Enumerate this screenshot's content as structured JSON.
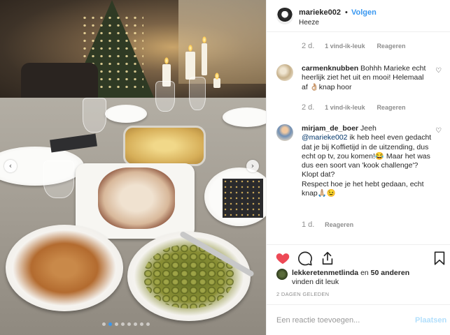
{
  "header": {
    "username": "marieke002",
    "separator": "•",
    "follow_label": "Volgen",
    "location": "Heeze"
  },
  "comments": [
    {
      "username": "",
      "text": "",
      "time": "2 d.",
      "likes": "1 vind-ik-leuk",
      "reply": "Reageren"
    },
    {
      "username": "carmenknubben",
      "text": "Bohhh Marieke echt heerlijk ziet het uit en mooi! Helemaal af 👌🏼knap hoor",
      "time": "2 d.",
      "likes": "1 vind-ik-leuk",
      "reply": "Reageren"
    },
    {
      "username": "mirjam_de_boer",
      "mention": "@marieke002",
      "text_before": "Jeeh",
      "text": "ik heb heel even gedacht dat je bij Koffietijd in de uitzending, dus echt op tv, zou komen!😂 Maar het was dus een soort van 'kook challenge'? Klopt dat?",
      "text_2": "Respect hoe je het hebt gedaan, echt knap🙏🏼😉",
      "time": "1 d.",
      "reply": "Reageren"
    }
  ],
  "likes": {
    "first_liker": "lekkeretenmetlinda",
    "connector": "en",
    "others": "50 anderen",
    "suffix": "vinden dit leuk"
  },
  "timestamp": "2 DAGEN GELEDEN",
  "add_comment": {
    "placeholder": "Een reactie toevoegen...",
    "post_label": "Plaatsen"
  },
  "icons": {
    "like": "heart-icon",
    "comment": "comment-icon",
    "share": "share-icon",
    "save": "bookmark-icon"
  },
  "colors": {
    "like_red": "#ed4956",
    "link_blue": "#3897f0",
    "post_disabled": "#b2dffc",
    "muted": "#8e8e8e"
  },
  "carousel": {
    "prev_arrow": "‹",
    "next_arrow": "›",
    "slide_count": 8,
    "active_slide": 1
  }
}
